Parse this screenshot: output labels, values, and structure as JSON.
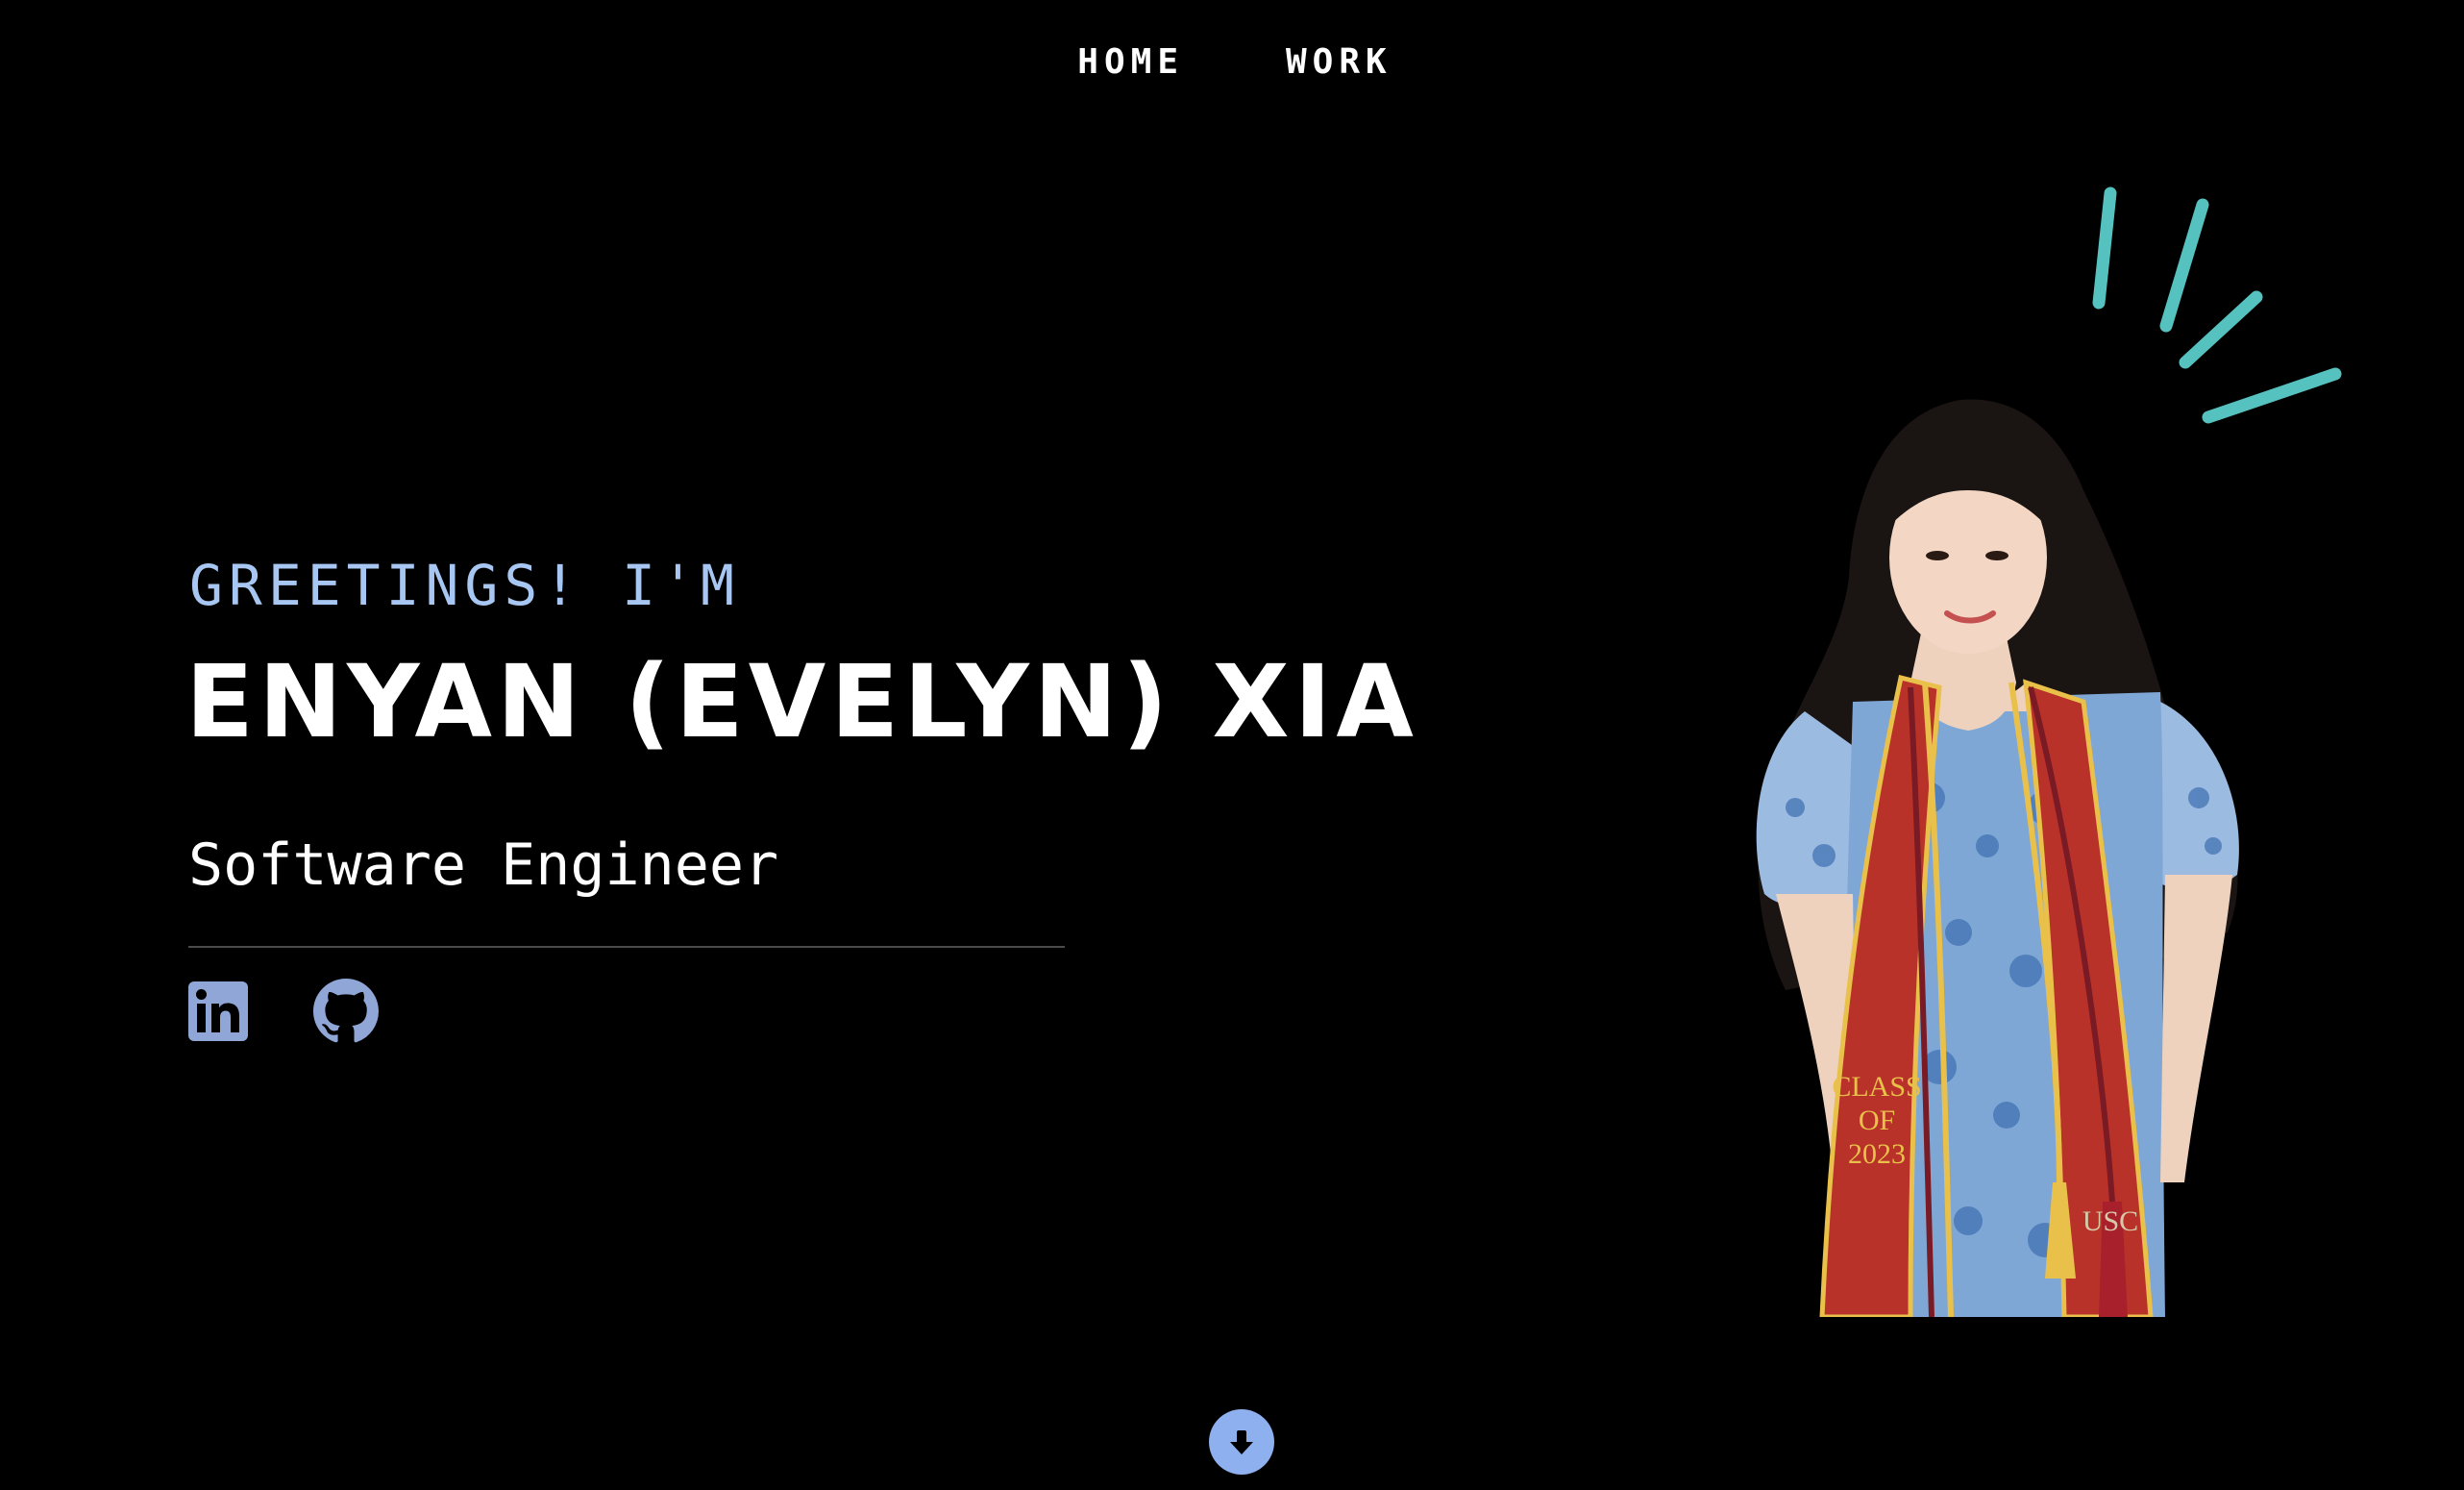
{
  "nav": {
    "items": [
      {
        "label": "HOME"
      },
      {
        "label": "WORK"
      }
    ]
  },
  "hero": {
    "greeting": "GREETINGS! I'M",
    "name": "ENYAN (EVELYN) XIA",
    "role": "Software Engineer"
  },
  "socials": [
    {
      "icon": "linkedin-icon"
    },
    {
      "icon": "github-icon"
    }
  ],
  "portrait": {
    "stole_text_lines": [
      "CLASS",
      "OF",
      "2023"
    ],
    "stole_school": "USC"
  },
  "colors": {
    "background": "#000000",
    "accent_blue": "#a7c6f1",
    "icon_blue": "#8fa6d6",
    "accent_teal": "#56c2c0",
    "stole_red": "#b8322a",
    "stole_gold": "#e9c04a"
  }
}
